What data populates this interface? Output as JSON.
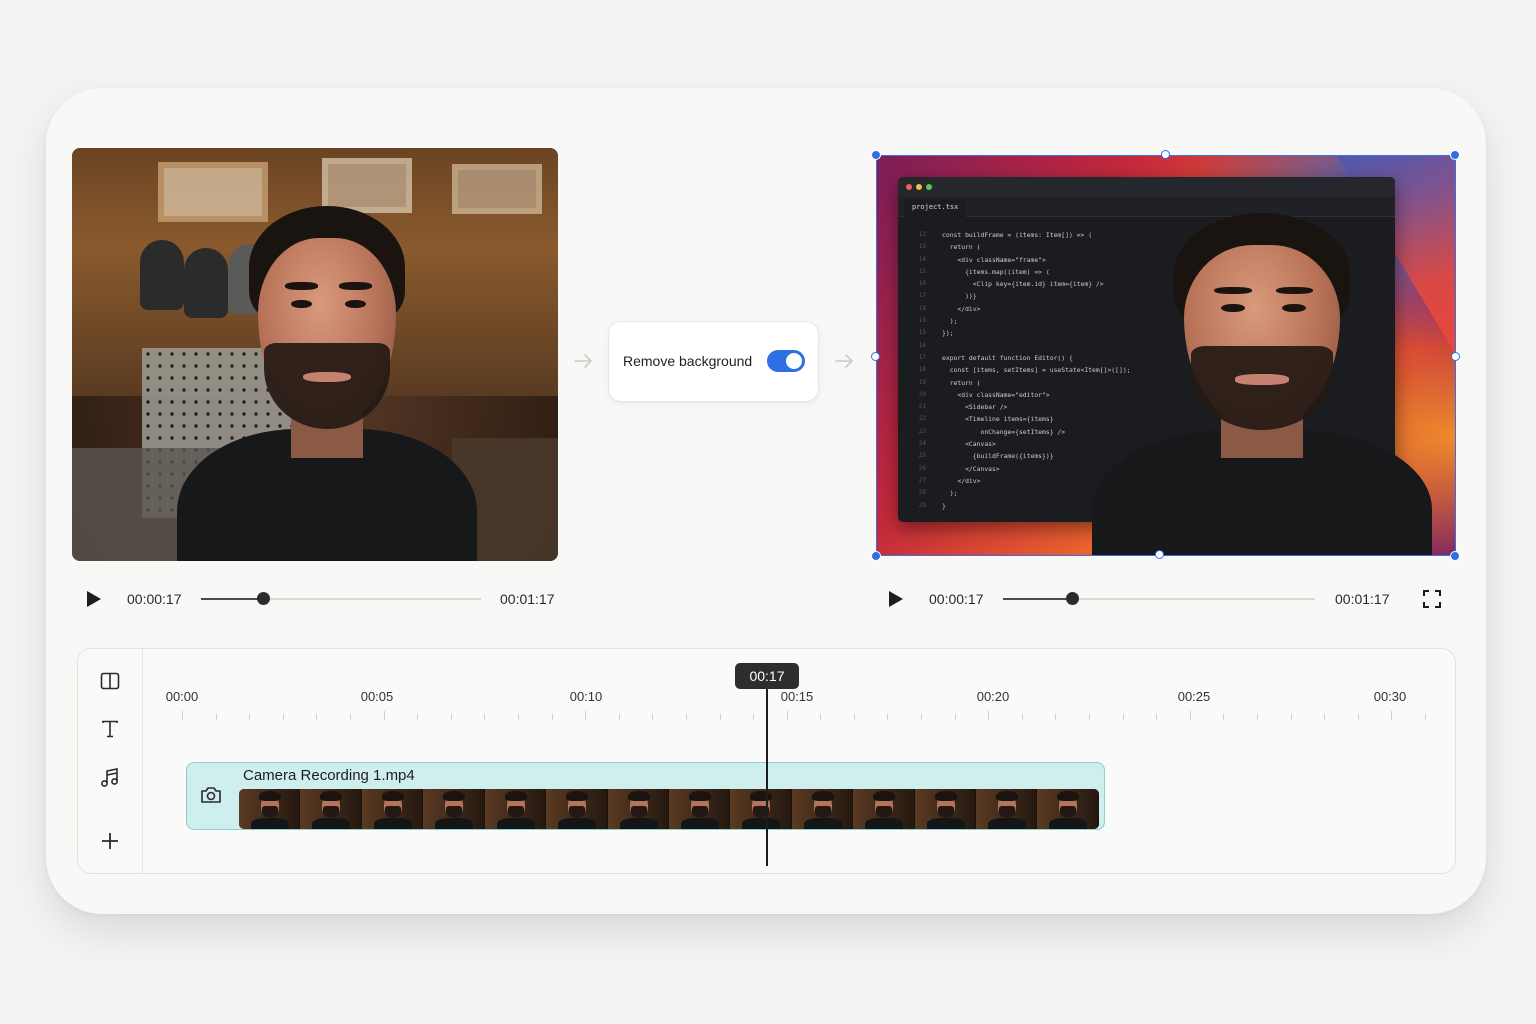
{
  "toggle": {
    "label": "Remove background",
    "enabled": true
  },
  "source_player": {
    "current_time": "00:00:17",
    "duration": "00:01:17",
    "progress": 0.22
  },
  "result_player": {
    "current_time": "00:00:17",
    "duration": "00:01:17",
    "progress": 0.22
  },
  "editor": {
    "tab": "project.tsx",
    "gutter": [
      "12",
      "13",
      "14",
      "15",
      "16",
      "17",
      "18",
      "19",
      "15",
      "16",
      "17",
      "18",
      "19",
      "20",
      "21",
      "22",
      "23",
      "24",
      "25",
      "26",
      "27",
      "28",
      "29"
    ],
    "code": "const buildFrame = (items: Item[]) => (\n  return (\n    <div className=\"frame\">\n      {items.map((item) => (\n        <Clip key={item.id} item={item} />\n      ))}\n    </div>\n  );\n});\n\nexport default function Editor() {\n  const [items, setItems] = useState<Item[]>([]);\n  return (\n    <div className=\"editor\">\n      <Sidebar />\n      <Timeline items={items}\n          onChange={setItems} />\n      <Canvas>\n        {buildFrame({items})}\n      </Canvas>\n    </div>\n  );\n}"
  },
  "timeline": {
    "ruler_labels": [
      "00:00",
      "00:05",
      "00:10",
      "00:15",
      "00:20",
      "00:25",
      "00:30"
    ],
    "playhead": "00:17",
    "clip": {
      "name": "Camera Recording 1.mp4",
      "frames": 14
    },
    "tools": [
      "layout-icon",
      "text-icon",
      "music-icon",
      "add-icon"
    ]
  },
  "colors": {
    "accent": "#2f6fe4",
    "clip_bg": "#cfeeee",
    "clip_border": "#88d0cf",
    "playhead": "#2e2e2e"
  }
}
